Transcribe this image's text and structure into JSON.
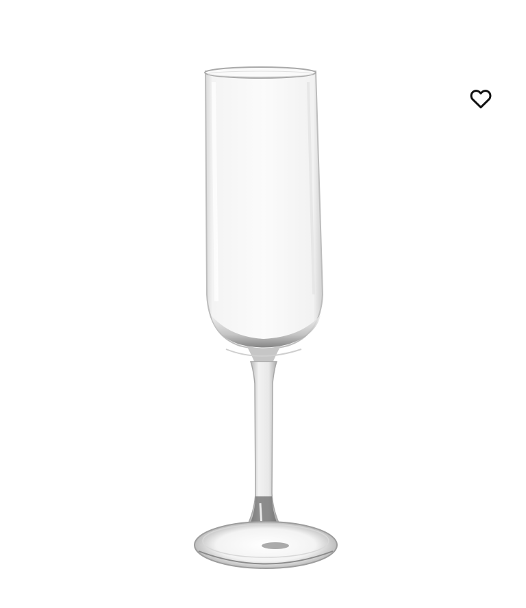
{
  "product": {
    "image_name": "champagne-flute-glass"
  },
  "favourite": {
    "icon": "heart-outline-icon",
    "color": "#111111"
  }
}
